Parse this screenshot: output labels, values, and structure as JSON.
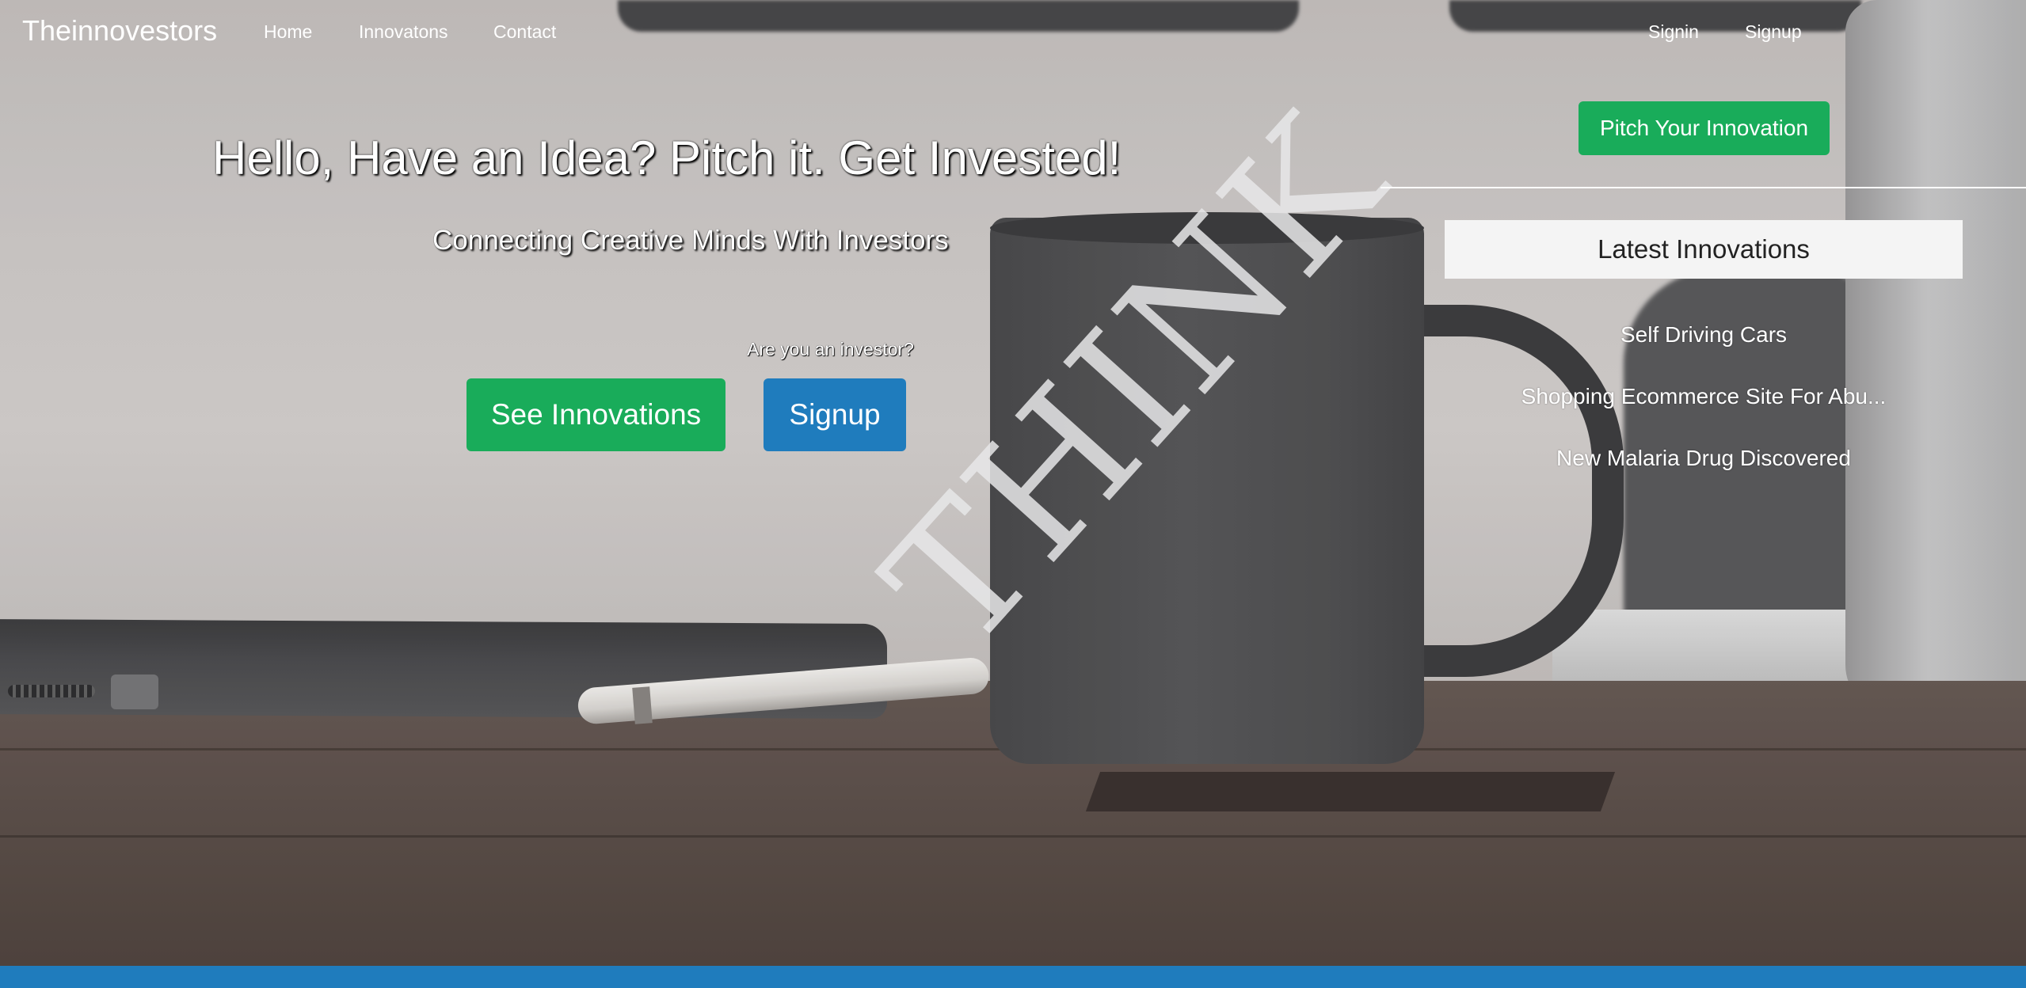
{
  "nav": {
    "brand": "Theinnovestors",
    "links": [
      {
        "label": "Home"
      },
      {
        "label": "Innovatons"
      },
      {
        "label": "Contact"
      }
    ],
    "auth": [
      {
        "label": "Signin"
      },
      {
        "label": "Signup"
      }
    ]
  },
  "hero": {
    "title": "Hello, Have an Idea? Pitch it. Get Invested!",
    "subtitle": "Connecting Creative Minds With Investors",
    "investor_question": "Are you an investor?",
    "see_innovations_label": "See Innovations",
    "signup_label": "Signup"
  },
  "sidebar": {
    "pitch_label": "Pitch Your Innovation",
    "latest_heading": "Latest Innovations",
    "items": [
      {
        "label": "Self Driving Cars"
      },
      {
        "label": "Shopping Ecommerce Site For Abu..."
      },
      {
        "label": "New Malaria Drug Discovered"
      }
    ]
  },
  "background": {
    "mug_text": "THINK"
  },
  "colors": {
    "green_button": "#19ac5a",
    "blue_button": "#1f7cbd",
    "footer_bar": "#1f7cbd"
  }
}
